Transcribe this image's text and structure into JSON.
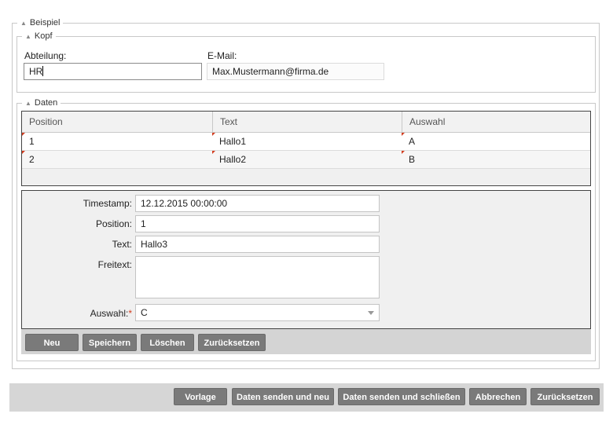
{
  "fieldsets": {
    "beispiel": "Beispiel",
    "kopf": "Kopf",
    "daten": "Daten"
  },
  "kopf": {
    "abteilung_label": "Abteilung:",
    "abteilung_value": "HR",
    "email_label": "E-Mail:",
    "email_value": "Max.Mustermann@firma.de"
  },
  "grid": {
    "columns": [
      "Position",
      "Text",
      "Auswahl"
    ],
    "rows": [
      {
        "position": "1",
        "text": "Hallo1",
        "auswahl": "A"
      },
      {
        "position": "2",
        "text": "Hallo2",
        "auswahl": "B"
      }
    ]
  },
  "detail": {
    "timestamp_label": "Timestamp:",
    "timestamp_value": "12.12.2015 00:00:00",
    "position_label": "Position:",
    "position_value": "1",
    "text_label": "Text:",
    "text_value": "Hallo3",
    "freitext_label": "Freitext:",
    "freitext_value": "",
    "auswahl_label": "Auswahl:",
    "auswahl_required": "*",
    "auswahl_value": "C"
  },
  "grid_buttons": {
    "neu": "Neu",
    "speichern": "Speichern",
    "loeschen": "Löschen",
    "zuruecksetzen": "Zurücksetzen"
  },
  "footer_buttons": {
    "vorlage": "Vorlage",
    "senden_neu": "Daten senden und neu",
    "senden_schliessen": "Daten senden und schließen",
    "abbrechen": "Abbrechen",
    "zuruecksetzen": "Zurücksetzen"
  },
  "icons": {
    "collapse": "triangle-up-icon",
    "dropdown": "chevron-down-icon"
  }
}
